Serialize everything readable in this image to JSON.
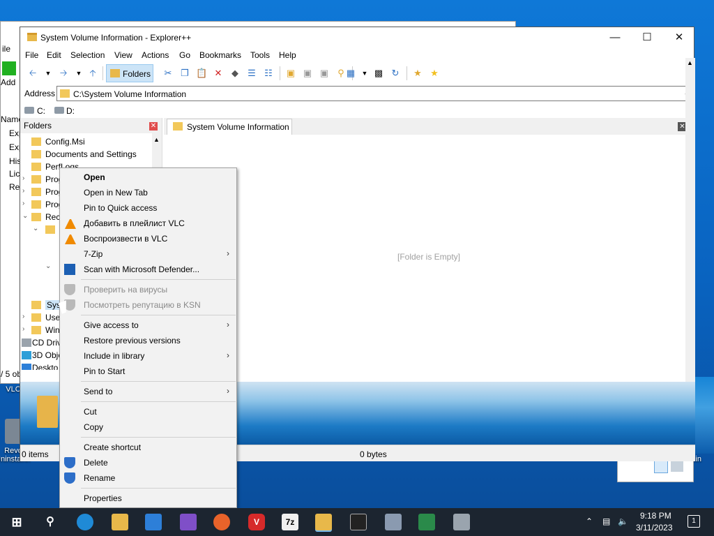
{
  "window": {
    "title": "System Volume Information - Explorer++"
  },
  "menu": [
    "File",
    "Edit",
    "Selection",
    "View",
    "Actions",
    "Go",
    "Bookmarks",
    "Tools",
    "Help"
  ],
  "toolbar": {
    "folders_label": "Folders"
  },
  "address": {
    "label": "Address",
    "value": "C:\\System Volume Information"
  },
  "drives": [
    "C:",
    "D:"
  ],
  "folders_pane": {
    "title": "Folders",
    "items": [
      "Config.Msi",
      "Documents and Settings",
      "PerfLogs",
      "Prog",
      "Prog",
      "Prog",
      "Rec",
      "Syst",
      "User",
      "Win",
      "CD Driv",
      "3D Obje",
      "Deskto"
    ]
  },
  "tab": {
    "label": "System Volume Information"
  },
  "content": {
    "empty_message": "[Folder is Empty]"
  },
  "status": {
    "items": "0 items",
    "size": "0 bytes"
  },
  "context_menu": [
    {
      "label": "Open",
      "bold": true
    },
    {
      "label": "Open in New Tab"
    },
    {
      "label": "Pin to Quick access"
    },
    {
      "label": "Добавить в плейлист VLC",
      "icon": "vlc-icon"
    },
    {
      "label": "Воспроизвести в VLC",
      "icon": "vlc-icon"
    },
    {
      "label": "7-Zip",
      "submenu": true
    },
    {
      "label": "Scan with Microsoft Defender...",
      "icon": "defender-icon"
    },
    {
      "label": "Проверить на вирусы",
      "disabled": true,
      "icon": "kaspersky-icon"
    },
    {
      "label": "Посмотреть репутацию в KSN",
      "disabled": true,
      "icon": "kaspersky-icon"
    },
    {
      "label": "Give access to",
      "submenu": true
    },
    {
      "label": "Restore previous versions"
    },
    {
      "label": "Include in library",
      "submenu": true
    },
    {
      "label": "Pin to Start"
    },
    {
      "label": "Send to",
      "submenu": true
    },
    {
      "label": "Cut"
    },
    {
      "label": "Copy"
    },
    {
      "label": "Create shortcut"
    },
    {
      "label": "Delete",
      "icon": "uac-shield-icon"
    },
    {
      "label": "Rename",
      "icon": "uac-shield-icon"
    },
    {
      "label": "Properties"
    }
  ],
  "bg_window": {
    "rows": [
      "ile",
      "Add",
      "Name",
      "Exp",
      "Exp",
      "His",
      "Lic",
      "Rea",
      "/ 5 ob"
    ]
  },
  "desktop_icons": {
    "vlc": "VLC",
    "revo": "Revo Uninstaller",
    "recycle": "Bin"
  },
  "taskbar": {
    "time": "9:18 PM",
    "date": "3/11/2023",
    "notifications": "1"
  }
}
